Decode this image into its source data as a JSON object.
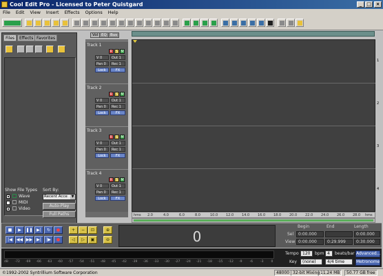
{
  "window": {
    "title": "Cool Edit Pro  - Licensed to Peter Quistgard",
    "controls": [
      "_",
      "□",
      "×"
    ]
  },
  "menu": [
    "File",
    "Edit",
    "View",
    "Insert",
    "Effects",
    "Options",
    "Help"
  ],
  "left_panel": {
    "tabs": [
      "Files",
      "Effects",
      "Favorites"
    ],
    "show_file_types_label": "Show File Types",
    "file_types": [
      {
        "label": "Wave",
        "checked": true
      },
      {
        "label": "MIDI",
        "checked": false
      },
      {
        "label": "Video",
        "checked": true
      }
    ],
    "sort_by_label": "Sort By:",
    "sort_by_value": "Recent Acce",
    "auto_play_label": "Auto-Play",
    "full_paths_label": "Full Paths"
  },
  "view_tabs": [
    "Vol",
    "EQ",
    "Bus"
  ],
  "tracks": [
    {
      "name": "Track 1",
      "volume": "V 0",
      "pan": "Pan 0",
      "out": "Out 1",
      "rec": "Rec 1",
      "lock": "Lock",
      "fx": "FX",
      "number": "1"
    },
    {
      "name": "Track 2",
      "volume": "V 0",
      "pan": "Pan 0",
      "out": "Out 1",
      "rec": "Rec 1",
      "lock": "Lock",
      "fx": "FX",
      "number": "2"
    },
    {
      "name": "Track 3",
      "volume": "V 0",
      "pan": "Pan 0",
      "out": "Out 1",
      "rec": "Rec 1",
      "lock": "Lock",
      "fx": "FX",
      "number": "3"
    },
    {
      "name": "Track 4",
      "volume": "V 0",
      "pan": "Pan 0",
      "out": "Out 1",
      "rec": "Rec 1",
      "lock": "Lock",
      "fx": "FX",
      "number": "4"
    }
  ],
  "track_button_labels": {
    "r": "R",
    "s": "S",
    "m": "M"
  },
  "ruler": {
    "start_label": "hms",
    "end_label": "hms",
    "ticks": [
      "2.0",
      "4.0",
      "6.0",
      "8.0",
      "10.0",
      "12.0",
      "14.0",
      "16.0",
      "18.0",
      "20.0",
      "22.0",
      "24.0",
      "26.0",
      "28.0"
    ]
  },
  "transport": {
    "time_display": "0"
  },
  "selection": {
    "headers": [
      "Begin",
      "End",
      "Length"
    ],
    "rows": [
      {
        "label": "Sel",
        "begin": "0:00.000",
        "end": "",
        "length": "0:00.000"
      },
      {
        "label": "View",
        "begin": "0:00.000",
        "end": "0:29.999",
        "length": "0:30.000"
      }
    ]
  },
  "tempo": {
    "tempo_label": "Tempo",
    "tempo_value": "120",
    "bpm_label": "bpm",
    "beats_value": "4",
    "beats_label": "beats/bar",
    "key_label": "Key",
    "key_value": "(none)",
    "time_sig": "4/4 time",
    "advanced_label": "Advanced...",
    "metronome_label": "Metronome"
  },
  "level_meter": {
    "db_labels": [
      "dB",
      "-72",
      "-69",
      "-66",
      "-63",
      "-60",
      "-57",
      "-54",
      "-51",
      "-48",
      "-45",
      "-42",
      "-39",
      "-36",
      "-33",
      "-30",
      "-27",
      "-24",
      "-21",
      "-18",
      "-15",
      "-12",
      "-9",
      "-6",
      "-3",
      "0"
    ]
  },
  "status": {
    "copyright": "©1992-2002 Syntrillium Software Corporation",
    "sample_rate": "48000",
    "bit_mixing": "32-bit Mixing",
    "memory": "11.24 MB",
    "disk_free": "50.77 GB free"
  },
  "colors": {
    "title_start": "#0a246a",
    "title_end": "#3a6ea5",
    "record": "#c83030",
    "solo": "#c8b030",
    "mute": "#30a040",
    "transport_blue": "#4a66b0",
    "zoom_yellow": "#d8c24a",
    "scroll_green": "#5aaf5a"
  }
}
